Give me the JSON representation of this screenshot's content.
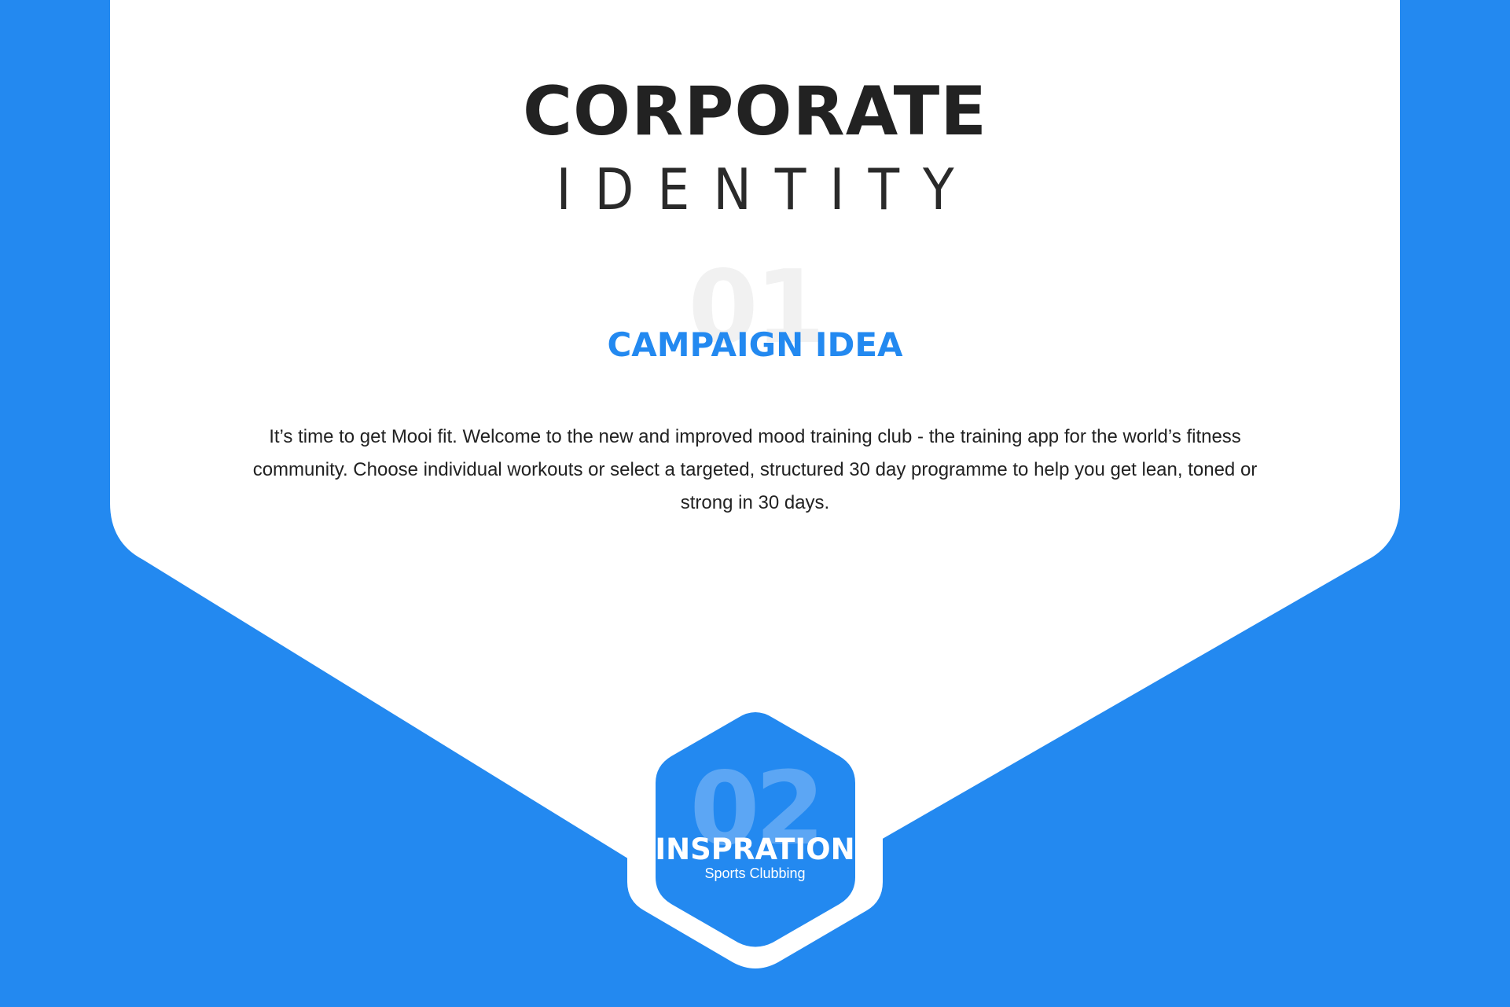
{
  "colors": {
    "background": "#2389f0",
    "card": "#ffffff",
    "accent": "#2389f0",
    "heading": "#222222",
    "ghost_number_light": "#f1f1f1",
    "ghost_number_blue": "#5ca6f4"
  },
  "header": {
    "title": "CORPORATE",
    "subtitle": "IDENTITY"
  },
  "section_1": {
    "number": "01",
    "title": "CAMPAIGN IDEA",
    "body": "It’s time to get Mooi fit. Welcome to the new and improved mood training club - the training app for the world’s fitness community. Choose individual workouts or select a targeted, structured 30 day programme to help you get lean, toned or strong in 30 days."
  },
  "section_2": {
    "number": "02",
    "title": "INSPRATION",
    "caption": "Sports Clubbing"
  }
}
